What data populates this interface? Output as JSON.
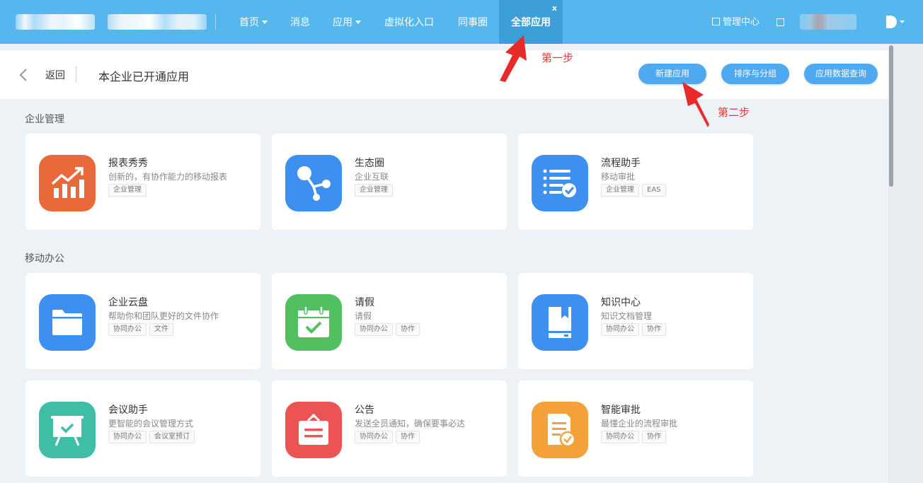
{
  "nav": {
    "items": [
      {
        "label": "首页",
        "has_caret": true
      },
      {
        "label": "消息",
        "has_caret": false
      },
      {
        "label": "应用",
        "has_caret": true
      },
      {
        "label": "虚拟化入口",
        "has_caret": false
      },
      {
        "label": "同事圈",
        "has_caret": false
      }
    ],
    "active_tab": {
      "label": "全部应用",
      "close": "x"
    },
    "admin_center": "管理中心",
    "brand_color": "#56b6ee"
  },
  "subheader": {
    "back": "返回",
    "title": "本企业已开通应用",
    "buttons": {
      "new_app": "新建应用",
      "sort_group": "排序与分组",
      "data_query": "应用数据查询"
    }
  },
  "annotations": {
    "step1": "第一步",
    "step2": "第二步"
  },
  "sections": [
    {
      "title": "企业管理",
      "apps": [
        {
          "name": "报表秀秀",
          "desc": "创新的，有协作能力的移动报表",
          "tags": [
            "企业管理"
          ],
          "icon": "bar-chart-icon",
          "color": "#e8693a"
        },
        {
          "name": "生态圈",
          "desc": "企业互联",
          "tags": [
            "企业管理"
          ],
          "icon": "share-nodes-icon",
          "color": "#3d8ff0"
        },
        {
          "name": "流程助手",
          "desc": "移动审批",
          "tags": [
            "企业管理",
            "EAS"
          ],
          "icon": "checklist-icon",
          "color": "#3d8ff0"
        }
      ]
    },
    {
      "title": "移动办公",
      "apps": [
        {
          "name": "企业云盘",
          "desc": "帮助你和团队更好的文件协作",
          "tags": [
            "协同办公",
            "文件"
          ],
          "icon": "folder-icon",
          "color": "#3d8ff0"
        },
        {
          "name": "请假",
          "desc": "请假",
          "tags": [
            "协同办公",
            "协作"
          ],
          "icon": "calendar-check-icon",
          "color": "#52c060"
        },
        {
          "name": "知识中心",
          "desc": "知识文档管理",
          "tags": [
            "协同办公",
            "协作"
          ],
          "icon": "book-icon",
          "color": "#3d8ff0"
        },
        {
          "name": "会议助手",
          "desc": "更智能的会议管理方式",
          "tags": [
            "协同办公",
            "会议室预订"
          ],
          "icon": "presentation-board-icon",
          "color": "#3fbea5"
        },
        {
          "name": "公告",
          "desc": "发送全员通知，确保要事必达",
          "tags": [
            "协同办公",
            "协作"
          ],
          "icon": "notice-board-icon",
          "color": "#ec5353"
        },
        {
          "name": "智能审批",
          "desc": "最懂企业的流程审批",
          "tags": [
            "协同办公",
            "协作"
          ],
          "icon": "document-approve-icon",
          "color": "#f5a13a"
        }
      ]
    }
  ]
}
